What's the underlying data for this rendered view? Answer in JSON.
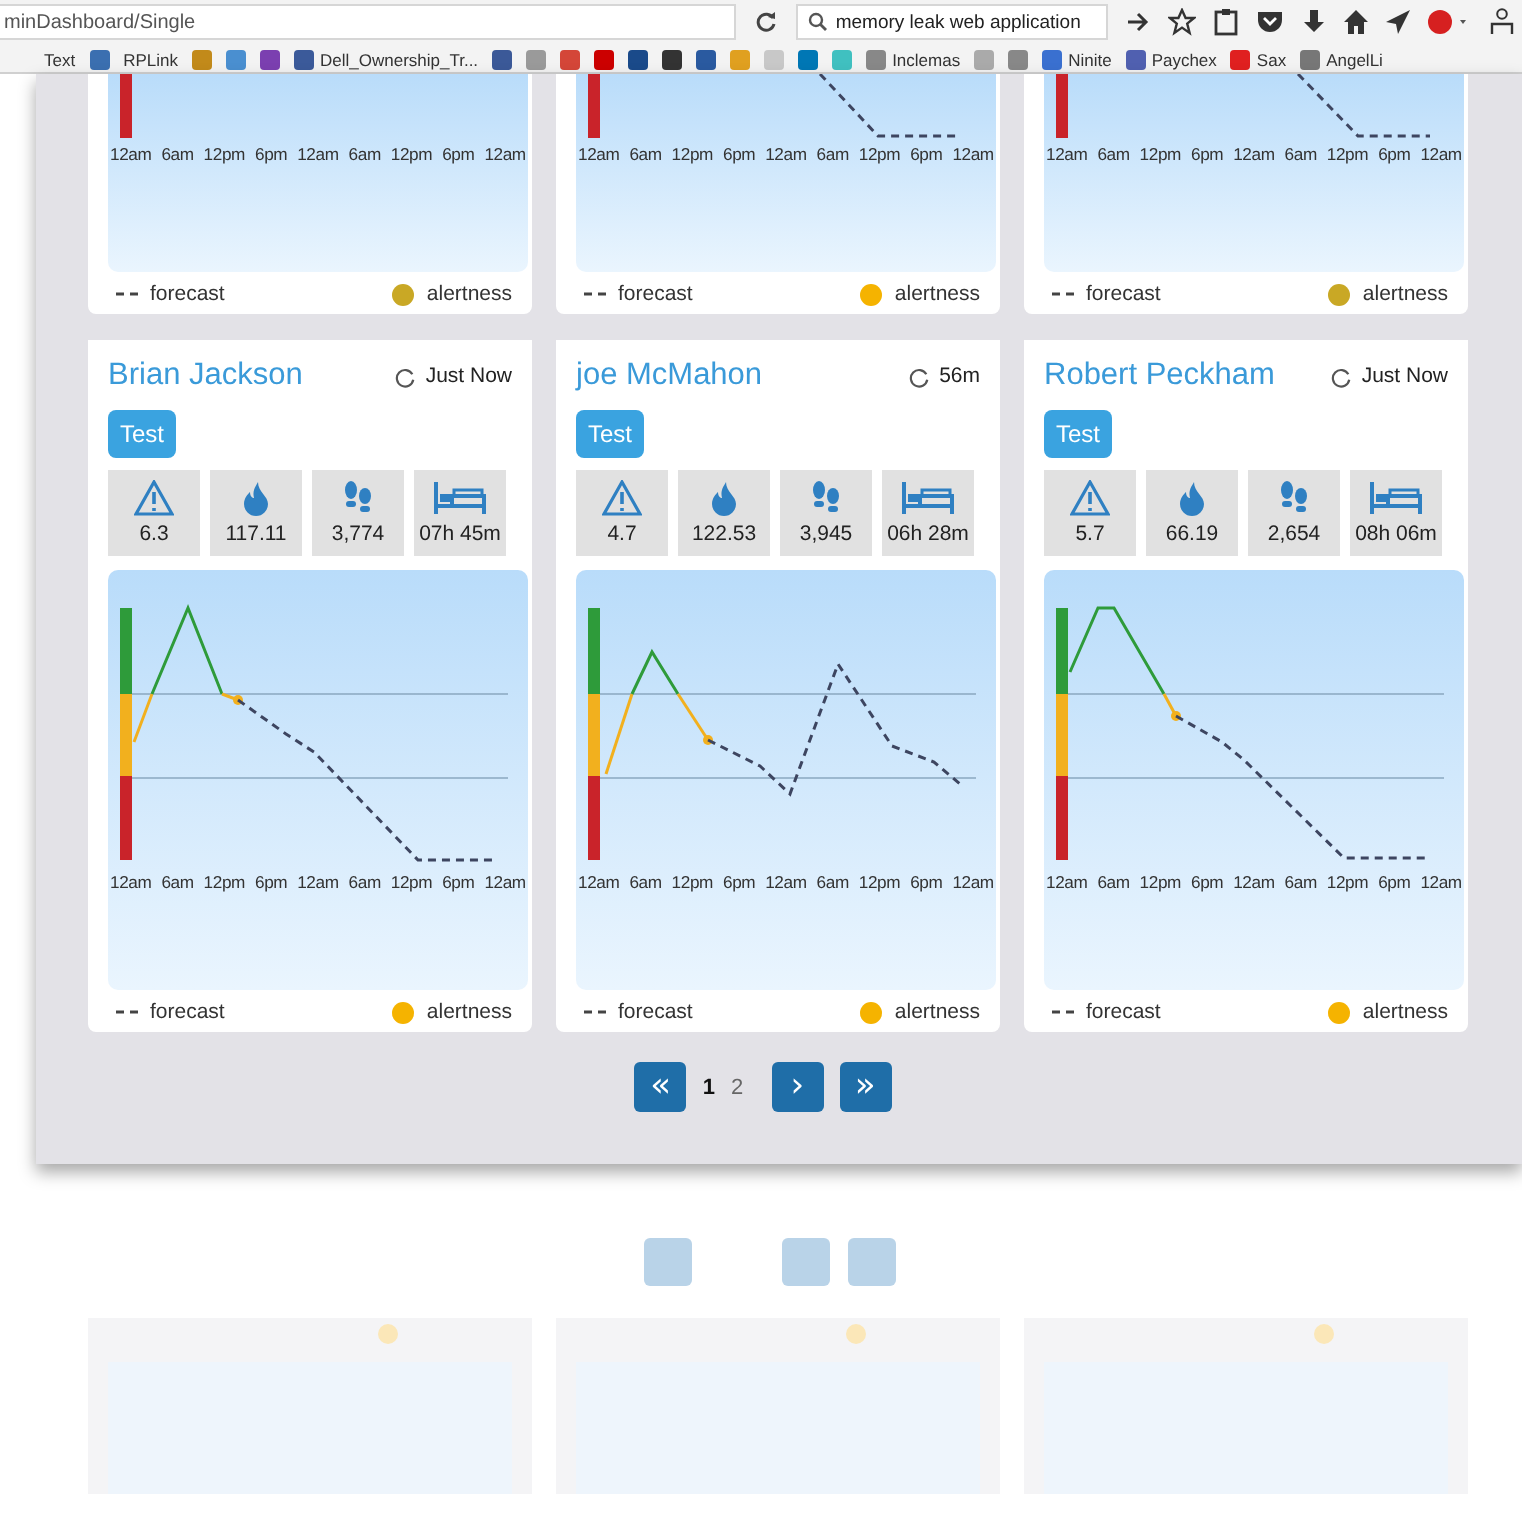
{
  "browser": {
    "url": "minDashboard/Single",
    "search": {
      "value": "memory leak web application"
    },
    "bookmarks": [
      {
        "label": "Text"
      },
      {
        "color": "#3b6fb0"
      },
      {
        "label": "RPLink"
      },
      {
        "color": "#c28a1a"
      },
      {
        "color": "#4a8fd0"
      },
      {
        "color": "#7b3fb0"
      },
      {
        "label": "Dell_Ownership_Tr...",
        "color": "#3b5a9a"
      },
      {
        "color": "#3b5998"
      },
      {
        "color": "#9a9a9a"
      },
      {
        "color": "#d44638"
      },
      {
        "color": "#cc0000"
      },
      {
        "color": "#1a4a8a"
      },
      {
        "color": "#333333"
      },
      {
        "color": "#2a5aa0"
      },
      {
        "color": "#e0a020"
      },
      {
        "color": "#c8c8c8"
      },
      {
        "color": "#0077b5"
      },
      {
        "color": "#40c0c0"
      },
      {
        "label": "Inclemas",
        "color": "#888888"
      },
      {
        "color": "#aaaaaa"
      },
      {
        "color": "#888888"
      },
      {
        "label": "Ninite",
        "color": "#3a70d0"
      },
      {
        "label": "Paychex",
        "color": "#5060b0"
      },
      {
        "label": "Sax",
        "color": "#e02020"
      },
      {
        "label": "AngelLi",
        "color": "#777777"
      }
    ]
  },
  "top_cards": [
    {
      "x_labels": [
        "12am",
        "6am",
        "12pm",
        "6pm",
        "12am",
        "6am",
        "12pm",
        "6pm",
        "12am"
      ],
      "legend": {
        "forecast": "forecast",
        "alertness": "alertness",
        "color": "#c9a825"
      }
    },
    {
      "x_labels": [
        "12am",
        "6am",
        "12pm",
        "6pm",
        "12am",
        "6am",
        "12pm",
        "6pm",
        "12am"
      ],
      "legend": {
        "forecast": "forecast",
        "alertness": "alertness",
        "color": "#f5b300"
      }
    },
    {
      "x_labels": [
        "12am",
        "6am",
        "12pm",
        "6pm",
        "12am",
        "6am",
        "12pm",
        "6pm",
        "12am"
      ],
      "legend": {
        "forecast": "forecast",
        "alertness": "alertness",
        "color": "#c9a825"
      }
    }
  ],
  "cards": [
    {
      "name": "Brian Jackson",
      "updated": "Just Now",
      "button": "Test",
      "stats": [
        {
          "kind": "warning",
          "value": "6.3"
        },
        {
          "kind": "flame",
          "value": "117.11"
        },
        {
          "kind": "steps",
          "value": "3,774"
        },
        {
          "kind": "sleep",
          "value": "07h 45m"
        }
      ],
      "x_labels": [
        "12am",
        "6am",
        "12pm",
        "6pm",
        "12am",
        "6am",
        "12pm",
        "6pm",
        "12am"
      ],
      "legend": {
        "forecast": "forecast",
        "alertness": "alertness",
        "color": "#f5b300"
      }
    },
    {
      "name": "joe McMahon",
      "updated": "56m",
      "button": "Test",
      "stats": [
        {
          "kind": "warning",
          "value": "4.7"
        },
        {
          "kind": "flame",
          "value": "122.53"
        },
        {
          "kind": "steps",
          "value": "3,945"
        },
        {
          "kind": "sleep",
          "value": "06h 28m"
        }
      ],
      "x_labels": [
        "12am",
        "6am",
        "12pm",
        "6pm",
        "12am",
        "6am",
        "12pm",
        "6pm",
        "12am"
      ],
      "legend": {
        "forecast": "forecast",
        "alertness": "alertness",
        "color": "#f5b300"
      }
    },
    {
      "name": "Robert Peckham",
      "updated": "Just Now",
      "button": "Test",
      "stats": [
        {
          "kind": "warning",
          "value": "5.7"
        },
        {
          "kind": "flame",
          "value": "66.19"
        },
        {
          "kind": "steps",
          "value": "2,654"
        },
        {
          "kind": "sleep",
          "value": "08h 06m"
        }
      ],
      "x_labels": [
        "12am",
        "6am",
        "12pm",
        "6pm",
        "12am",
        "6am",
        "12pm",
        "6pm",
        "12am"
      ],
      "legend": {
        "forecast": "forecast",
        "alertness": "alertness",
        "color": "#f5b300"
      }
    }
  ],
  "pagination": {
    "first": "«",
    "pages": [
      {
        "label": "1",
        "selected": true
      },
      {
        "label": "2",
        "selected": false
      }
    ],
    "next": "›",
    "last": "»"
  }
}
